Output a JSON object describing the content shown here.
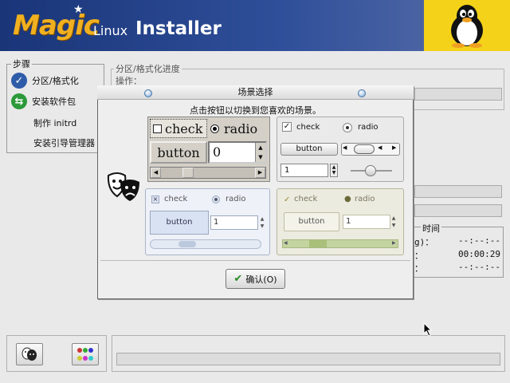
{
  "header": {
    "brand_magic": "Magic",
    "brand_linux": "Linux",
    "brand_installer": "Installer"
  },
  "steps": {
    "title": "步骤",
    "items": [
      {
        "label": "分区/格式化",
        "icon": "check-circle-icon",
        "color": "#2e5ca8"
      },
      {
        "label": "安装软件包",
        "icon": "arrows-circle-icon",
        "color": "#2c9a3a"
      },
      {
        "label": "制作 initrd"
      },
      {
        "label": "安装引导管理器"
      }
    ]
  },
  "progress": {
    "section_title": "分区/格式化进度",
    "op_label": "操作："
  },
  "time": {
    "title": "时间",
    "rows": [
      {
        "label": "g)：",
        "value": "--:--:--"
      },
      {
        "label": "：",
        "value": "00:00:29"
      },
      {
        "label": "：",
        "value": "--:--:--"
      }
    ]
  },
  "dialog": {
    "title": "场景选择",
    "instruction": "点击按钮以切换到您喜欢的场景。",
    "confirm_label": "确认(O)",
    "themes": [
      {
        "check": "check",
        "radio": "radio",
        "button": "button",
        "spin_value": "0"
      },
      {
        "check": "check",
        "radio": "radio",
        "button": "button",
        "spin_value": "1"
      },
      {
        "check": "check",
        "radio": "radio",
        "button": "button",
        "spin_value": "1"
      },
      {
        "check": "check",
        "radio": "radio",
        "button": "button",
        "spin_value": "1"
      }
    ]
  },
  "colors": {
    "banner": "#1a3578",
    "brand_accent": "#f0b020",
    "penguin_bg": "#f4d21a"
  }
}
